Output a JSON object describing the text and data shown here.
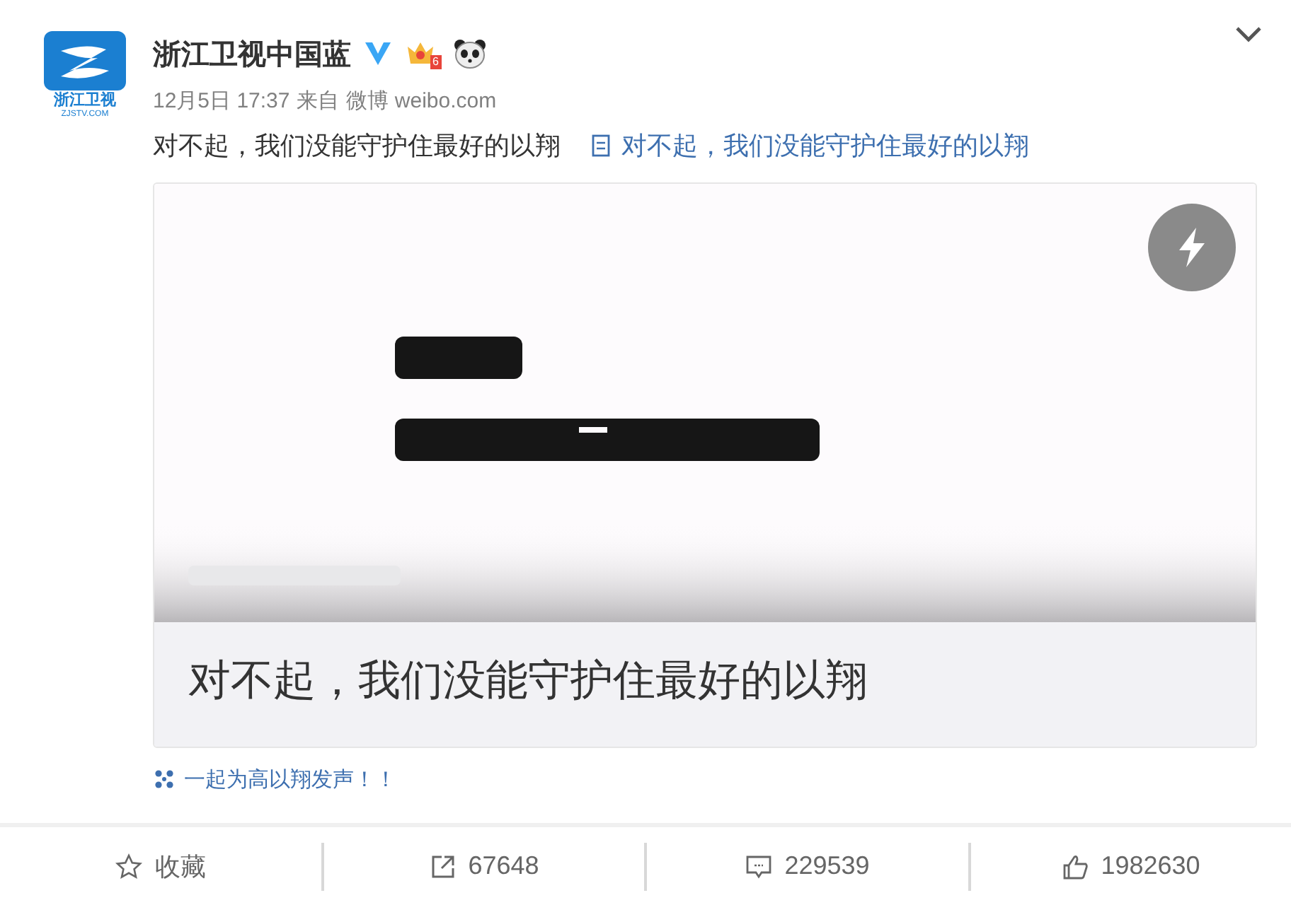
{
  "avatar": {
    "logo_text": "浙江卫视",
    "logo_url": "ZJSTV.COM"
  },
  "post": {
    "author": "浙江卫视中国蓝",
    "verified": true,
    "member_badge": "6",
    "time": "12月5日 17:37",
    "source_prefix": "来自",
    "source": "微博 weibo.com",
    "text": "对不起，我们没能守护住最好的以翔",
    "link": "对不起，我们没能守护住最好的以翔"
  },
  "card": {
    "caption": "对不起，我们没能守护住最好的以翔"
  },
  "topic": "一起为高以翔发声！！",
  "actions": [
    {
      "kind": "favorite",
      "label": "收藏"
    },
    {
      "kind": "repost",
      "label": "67648"
    },
    {
      "kind": "comment",
      "label": "229539"
    },
    {
      "kind": "like",
      "label": "1982630"
    }
  ]
}
